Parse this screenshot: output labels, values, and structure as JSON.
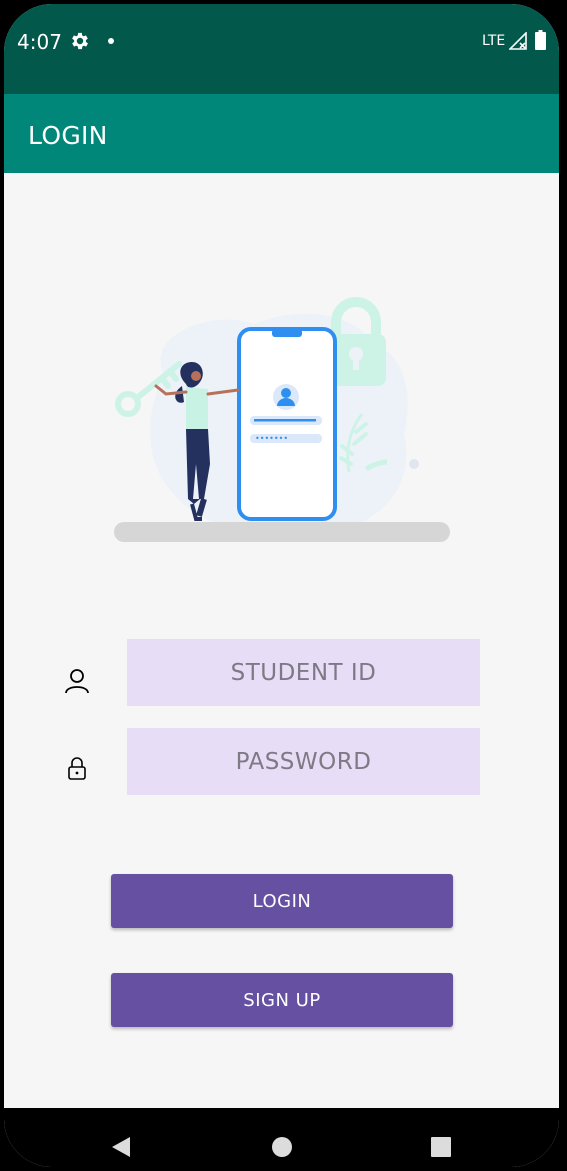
{
  "status_bar": {
    "time": "4:07",
    "network": "LTE",
    "background_color": "#01584b"
  },
  "app_bar": {
    "title": "LOGIN",
    "background_color": "#00877a"
  },
  "illustration": {
    "description_icon": "login-illustration-icon"
  },
  "form": {
    "student_id": {
      "placeholder": "STUDENT ID",
      "value": "",
      "icon": "person-icon"
    },
    "password": {
      "placeholder": "PASSWORD",
      "value": "",
      "icon": "lock-icon"
    },
    "field_color": "#e7ddf6"
  },
  "buttons": {
    "login_label": "LOGIN",
    "signup_label": "SIGN UP",
    "color": "#6650a2"
  },
  "nav_bar": {
    "back_icon": "back-triangle-icon",
    "home_icon": "home-circle-icon",
    "recents_icon": "recents-square-icon"
  }
}
